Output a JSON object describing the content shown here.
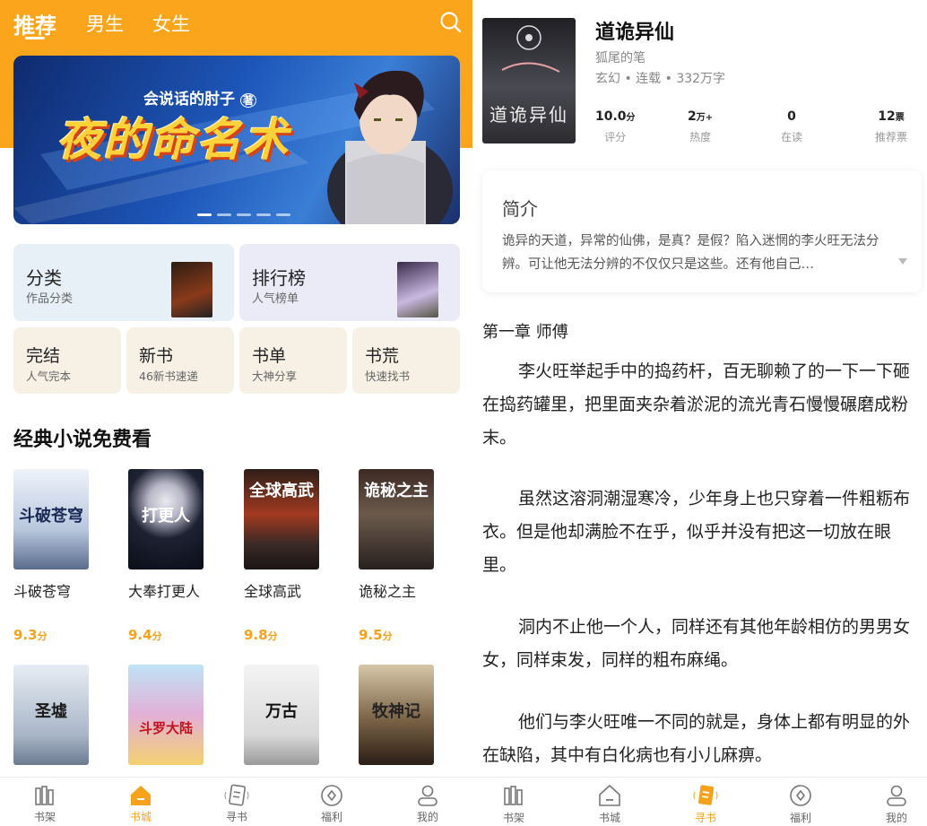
{
  "left": {
    "tabs": [
      "推荐",
      "男生",
      "女生"
    ],
    "banner": {
      "author": "会说话的肘子",
      "author_mark": "著",
      "title": "夜的命名术"
    },
    "categories_big": [
      {
        "title": "分类",
        "subtitle": "作品分类"
      },
      {
        "title": "排行榜",
        "subtitle": "人气榜单"
      }
    ],
    "categories_small": [
      {
        "title": "完结",
        "subtitle": "人气完本"
      },
      {
        "title": "新书",
        "subtitle": "46新书速递"
      },
      {
        "title": "书单",
        "subtitle": "大神分享"
      },
      {
        "title": "书荒",
        "subtitle": "快速找书"
      }
    ],
    "section_title": "经典小说免费看",
    "books_row1": [
      {
        "name": "斗破苍穹",
        "score": "9.3",
        "cover_text": "斗破苍穹"
      },
      {
        "name": "大奉打更人",
        "score": "9.4",
        "cover_text": "打更人"
      },
      {
        "name": "全球高武",
        "score": "9.8",
        "cover_text": "全球高武"
      },
      {
        "name": "诡秘之主",
        "score": "9.5",
        "cover_text": "诡秘之主"
      }
    ],
    "books_row2": [
      {
        "cover_text": "圣墟"
      },
      {
        "cover_text": "斗罗大陆"
      },
      {
        "cover_text": "万古"
      },
      {
        "cover_text": "牧神记"
      }
    ],
    "score_unit": "分",
    "nav": [
      "书架",
      "书城",
      "寻书",
      "福利",
      "我的"
    ],
    "nav_active": "书城"
  },
  "right": {
    "cover_text": "道诡异仙",
    "title": "道诡异仙",
    "author": "狐尾的笔",
    "meta": "玄幻 • 连载 • 332万字",
    "stats": [
      {
        "value": "10.0",
        "unit": "分",
        "label": "评分"
      },
      {
        "value": "2",
        "unit": "万+",
        "label": "热度"
      },
      {
        "value": "0",
        "unit": "",
        "label": "在读"
      },
      {
        "value": "12",
        "unit": "票",
        "label": "推荐票"
      }
    ],
    "intro_heading": "简介",
    "intro_text": "诡异的天道，异常的仙佛，是真？是假？陷入迷惘的李火旺无法分辨。可让他无法分辨的不仅仅只是这些。还有他自己…",
    "chapter_title": "第一章 师傅",
    "paragraphs": [
      "李火旺举起手中的捣药杆，百无聊赖了的一下一下砸在捣药罐里，把里面夹杂着淤泥的流光青石慢慢碾磨成粉末。",
      "虽然这溶洞潮湿寒冷，少年身上也只穿着一件粗粝布衣。但是他却满脸不在乎，似乎并没有把这一切放在眼里。",
      "洞内不止他一个人，同样还有其他年龄相仿的男男女女，同样束发，同样的粗布麻绳。",
      "他们与李火旺唯一不同的就是，身体上都有明显的外在缺陷，其中有白化病也有小儿麻痹。"
    ],
    "nav": [
      "书架",
      "书城",
      "寻书",
      "福利",
      "我的"
    ],
    "nav_active": "寻书"
  },
  "colors": {
    "accent": "#fba51c",
    "score": "#f6a21d"
  }
}
